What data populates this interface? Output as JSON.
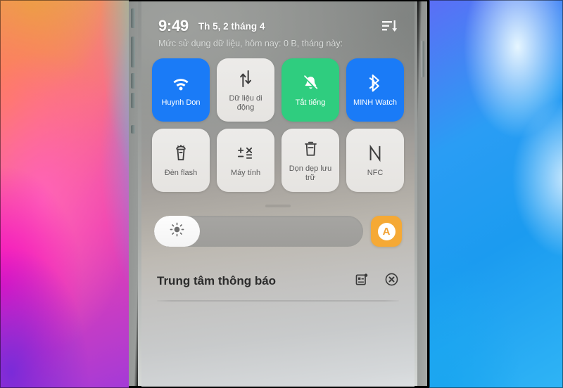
{
  "wallpapers": {
    "left_name": "gradient-wallpaper-pink",
    "right_name": "gradient-wallpaper-blue"
  },
  "statusbar": {
    "time": "9:49",
    "date": "Th 5, 2 tháng 4",
    "edit_icon": "sort-lines-arrow-icon"
  },
  "data_usage": {
    "text": "Mức sử dụng dữ liệu, hôm nay: 0 B, tháng này:"
  },
  "quick_settings": {
    "tiles": [
      {
        "label": "Huynh Don",
        "icon": "wifi-icon",
        "state": "on-blue",
        "badge": true,
        "name": "tile-wifi"
      },
      {
        "label": "Dữ liệu di động",
        "icon": "mobile-data-icon",
        "state": "off",
        "badge": false,
        "name": "tile-mobile-data"
      },
      {
        "label": "Tắt tiếng",
        "icon": "bell-muted-icon",
        "state": "on-green",
        "badge": false,
        "name": "tile-silent"
      },
      {
        "label": "MINH Watch",
        "icon": "bluetooth-icon",
        "state": "on-blue",
        "badge": true,
        "name": "tile-bluetooth"
      },
      {
        "label": "Đèn flash",
        "icon": "flashlight-icon",
        "state": "off",
        "badge": false,
        "name": "tile-flashlight"
      },
      {
        "label": "Máy tính",
        "icon": "calculator-icon",
        "state": "off",
        "badge": false,
        "name": "tile-calculator"
      },
      {
        "label": "Dọn dẹp lưu trữ",
        "icon": "trash-clean-icon",
        "state": "off",
        "badge": false,
        "name": "tile-storage-cleanup"
      },
      {
        "label": "NFC",
        "icon": "nfc-icon",
        "state": "off",
        "badge": false,
        "name": "tile-nfc"
      }
    ]
  },
  "brightness": {
    "icon": "brightness-sun-icon",
    "value_percent": 22,
    "auto_label": "A",
    "auto_icon": "auto-brightness-icon"
  },
  "notification_center": {
    "title": "Trung tâm thông báo",
    "settings_icon": "notification-settings-icon",
    "clear_icon": "clear-all-circle-x-icon"
  },
  "colors": {
    "accent_blue": "#1a7bf7",
    "accent_green": "#2fcd7f",
    "accent_orange": "#f5a935",
    "tile_off": "#ecebe9"
  }
}
